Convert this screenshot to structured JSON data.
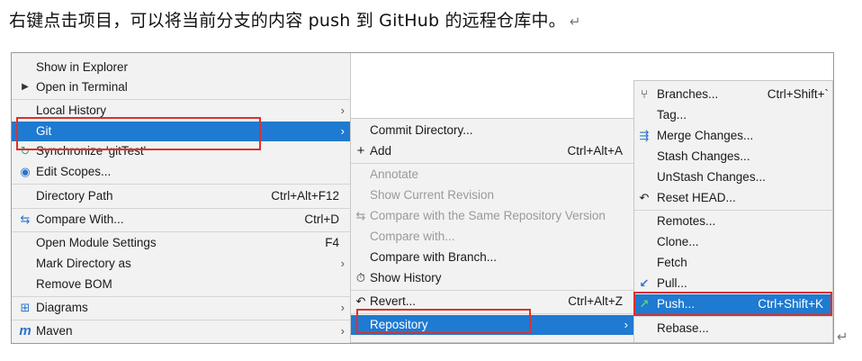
{
  "caption": "右键点击项目，可以将当前分支的内容 push 到 GitHub 的远程仓库中。",
  "return_mark": "↵",
  "left_menu": [
    {
      "label": "Show in Explorer"
    },
    {
      "label": "Open in Terminal",
      "icon": "▶"
    },
    {
      "label": "Local History",
      "arrow": "›"
    },
    {
      "label": "Git",
      "arrow": "›"
    },
    {
      "label": "Synchronize 'gitTest'",
      "icon": "↻"
    },
    {
      "label": "Edit Scopes...",
      "icon": "◉"
    },
    {
      "label": "Directory Path",
      "shortcut": "Ctrl+Alt+F12"
    },
    {
      "label": "Compare With...",
      "shortcut": "Ctrl+D",
      "icon": "⇆"
    },
    {
      "label": "Open Module Settings",
      "shortcut": "F4"
    },
    {
      "label": "Mark Directory as",
      "arrow": "›"
    },
    {
      "label": "Remove BOM"
    },
    {
      "label": "Diagrams",
      "arrow": "›",
      "icon": "⊞"
    },
    {
      "label": "Maven",
      "arrow": "›",
      "icon": "m"
    }
  ],
  "git_menu": [
    {
      "label": "Commit Directory..."
    },
    {
      "label": "Add",
      "shortcut": "Ctrl+Alt+A",
      "icon": "+"
    },
    {
      "label": "Annotate"
    },
    {
      "label": "Show Current Revision"
    },
    {
      "label": "Compare with the Same Repository Version",
      "icon": "⇆"
    },
    {
      "label": "Compare with..."
    },
    {
      "label": "Compare with Branch..."
    },
    {
      "label": "Show History",
      "icon": "⏱"
    },
    {
      "label": "Revert...",
      "shortcut": "Ctrl+Alt+Z",
      "icon": "↶"
    },
    {
      "label": "Repository",
      "arrow": "›"
    }
  ],
  "repo_menu": [
    {
      "label": "Branches...",
      "shortcut": "Ctrl+Shift+`",
      "icon": "⑂"
    },
    {
      "label": "Tag..."
    },
    {
      "label": "Merge Changes...",
      "icon": "⇶"
    },
    {
      "label": "Stash Changes..."
    },
    {
      "label": "UnStash Changes..."
    },
    {
      "label": "Reset HEAD...",
      "icon": "↶"
    },
    {
      "label": "Remotes..."
    },
    {
      "label": "Clone..."
    },
    {
      "label": "Fetch"
    },
    {
      "label": "Pull...",
      "icon": "↙"
    },
    {
      "label": "Push...",
      "shortcut": "Ctrl+Shift+K",
      "icon": "↗"
    },
    {
      "label": "Rebase..."
    }
  ],
  "colors": {
    "selection": "#1f7ad1",
    "highlight_box": "#e0302a",
    "push_icon": "#2e9e3a",
    "pull_icon": "#2a74c9"
  }
}
